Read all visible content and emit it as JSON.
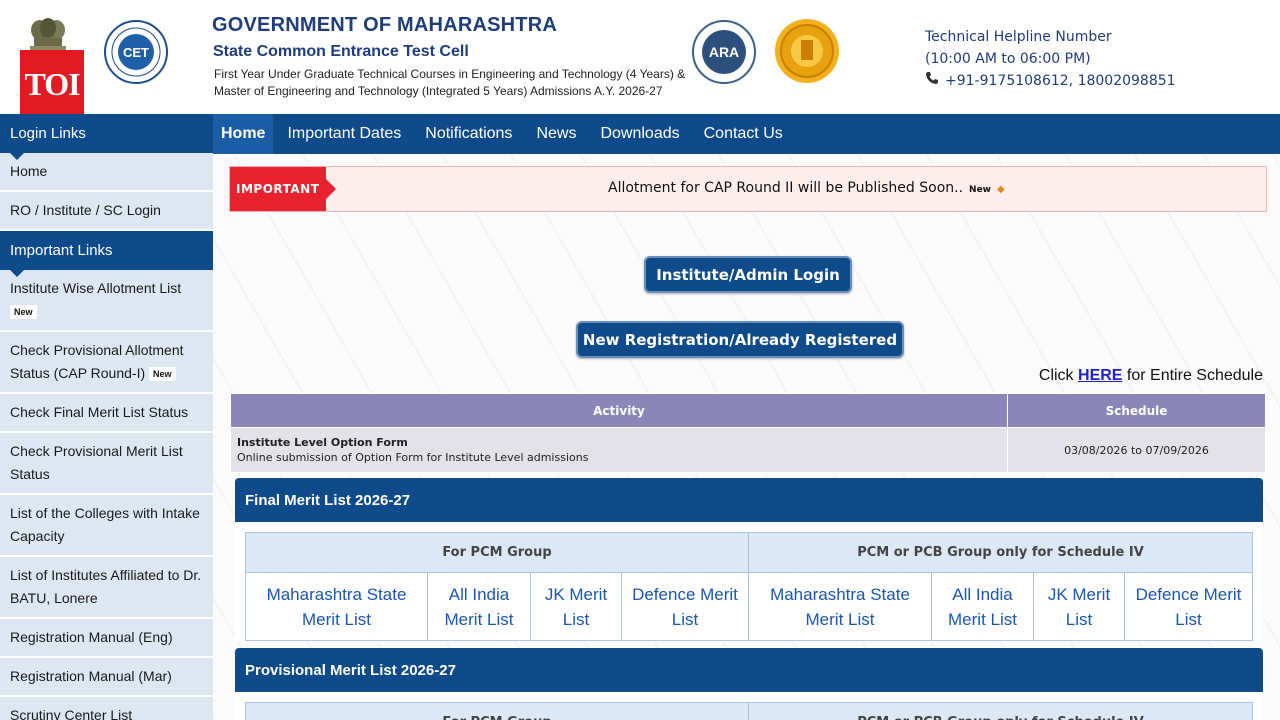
{
  "header": {
    "title": "GOVERNMENT OF MAHARASHTRA",
    "subtitle": "State Common Entrance Test Cell",
    "line1": "First Year Under Graduate Technical Courses in Engineering and Technology (4 Years) &",
    "line2": "Master of Engineering and Technology (Integrated 5 Years) Admissions A.Y. 2026-27",
    "toi_logo": "TOI",
    "cet_logo_text": "CET",
    "ara_logo_text": "ARA",
    "helpline_title": "Technical Helpline Number",
    "helpline_hours": "(10:00 AM to 06:00 PM)",
    "helpline_phones": "+91-9175108612, 18002098851"
  },
  "sidebar": {
    "login_heading": "Login Links",
    "login_items": [
      "Home",
      "RO / Institute / SC Login"
    ],
    "links_heading": "Important Links",
    "links": [
      {
        "label": "Institute Wise Allotment List",
        "badge": "New"
      },
      {
        "label": "Check Provisional Allotment Status (CAP Round-I)",
        "badge": "New"
      },
      {
        "label": "Check Final Merit List Status",
        "badge": ""
      },
      {
        "label": "Check Provisional Merit List Status",
        "badge": ""
      },
      {
        "label": "List of the Colleges with Intake Capacity",
        "badge": ""
      },
      {
        "label": "List of Institutes Affiliated to Dr. BATU, Lonere",
        "badge": ""
      },
      {
        "label": "Registration Manual (Eng)",
        "badge": ""
      },
      {
        "label": "Registration Manual (Mar)",
        "badge": ""
      },
      {
        "label": "Scrutiny Center List",
        "badge": ""
      }
    ]
  },
  "nav": {
    "items": [
      "Home",
      "Important Dates",
      "Notifications",
      "News",
      "Downloads",
      "Contact Us"
    ]
  },
  "notice": {
    "label": "IMPORTANT",
    "text": "Allotment for CAP Round II will be Published Soon..",
    "badge": "New",
    "bullet": "◆"
  },
  "buttons": {
    "login": "Institute/Admin Login",
    "register": "New Registration/Already Registered"
  },
  "schedule": {
    "prefix": "Click",
    "link": "HERE",
    "suffix": "for Entire Schedule"
  },
  "activity_table": {
    "headers": [
      "Activity",
      "Schedule"
    ],
    "row": {
      "title": "Institute Level Option Form",
      "desc": "Online submission of Option Form for Institute Level admissions",
      "schedule": "03/08/2026 to 07/09/2026"
    }
  },
  "final_merit": {
    "title": "Final Merit List 2026-27",
    "group_headers": [
      "For PCM Group",
      "PCM or PCB Group only for Schedule IV"
    ],
    "links": [
      "Maharashtra State Merit List",
      "All India Merit List",
      "JK Merit List",
      "Defence Merit List",
      "Maharashtra State Merit List",
      "All India Merit List",
      "JK Merit List",
      "Defence Merit List"
    ]
  },
  "provisional_merit": {
    "title": "Provisional Merit List 2026-27",
    "group_headers": [
      "For PCM Group",
      "PCM or PCB Group only for Schedule IV"
    ]
  },
  "colors": {
    "primary_blue": "#0f4a8a",
    "important_red": "#e8232f",
    "link_blue": "#1a56b4"
  }
}
